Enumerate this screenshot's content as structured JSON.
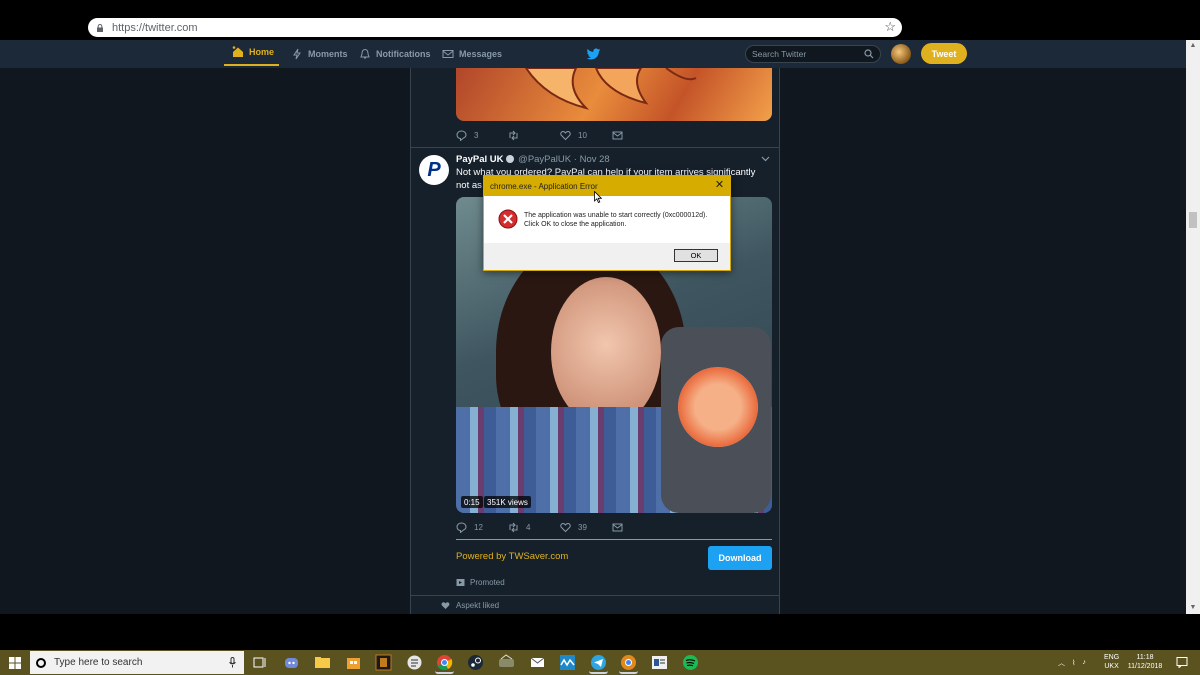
{
  "browser": {
    "url": "https://twitter.com"
  },
  "nav": {
    "home": "Home",
    "moments": "Moments",
    "notifications": "Notifications",
    "messages": "Messages",
    "search_placeholder": "Search Twitter",
    "tweet_button": "Tweet"
  },
  "previous_tweet": {
    "replies": "3",
    "retweets": "",
    "likes": "10"
  },
  "tweet": {
    "name": "PayPal UK",
    "handle": "@PayPalUK",
    "sep": "·",
    "date": "Nov 28",
    "text": "Not what you ordered? PayPal can help if your item arrives significantly not as described",
    "video_duration": "0:15",
    "video_views": "351K views",
    "replies": "12",
    "retweets": "4",
    "likes": "39"
  },
  "ad": {
    "powered_by": "Powered by TWSaver.com",
    "download_button": "Download",
    "promoted": "Promoted"
  },
  "activity": {
    "liked": "Aspekt liked"
  },
  "dialog": {
    "title": "chrome.exe - Application Error",
    "message_line1": "The application was unable to start correctly (0xc000012d).",
    "message_line2": "Click OK to close the application.",
    "ok": "OK"
  },
  "taskbar": {
    "search_placeholder": "Type here to search",
    "lang_line1": "ENG",
    "lang_line2": "UKX",
    "time": "11:18",
    "date": "11/12/2018"
  },
  "colors": {
    "accent": "#e0b11f",
    "twitter_blue": "#1da1f2",
    "nav_bg": "#1c2938",
    "timeline_bg": "#15202b",
    "dialog_title": "#d6ac00",
    "taskbar": "#5a5320"
  }
}
